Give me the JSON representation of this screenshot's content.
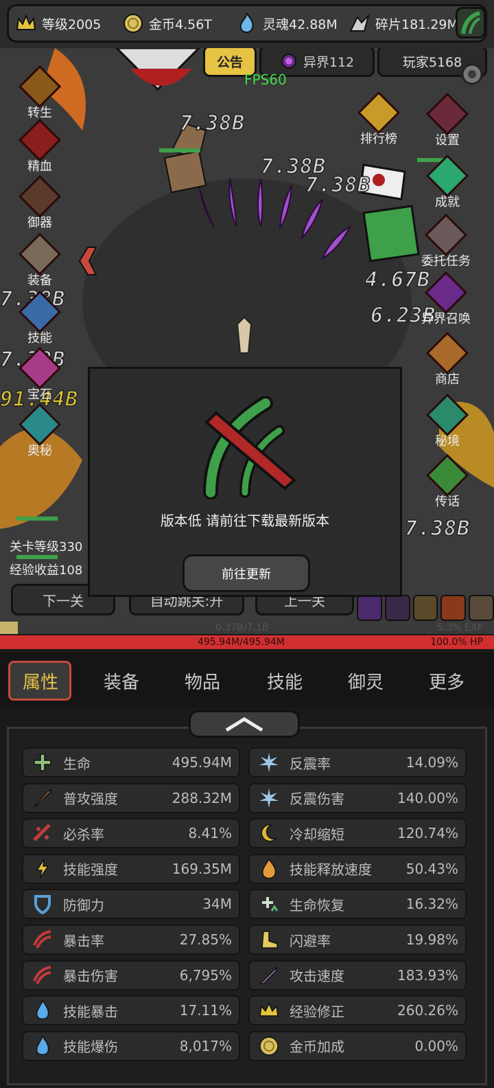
{
  "topbar": {
    "level": "等级2005",
    "gold": "金币4.56T",
    "soul": "灵魂42.88M",
    "shard": "碎片181.29M"
  },
  "header": {
    "notice_tab": "公告",
    "realm_label": "异界112",
    "players": "玩家5168",
    "fps": "FPS60"
  },
  "left_menu": [
    "转生",
    "精血",
    "御器",
    "装备",
    "技能",
    "宝石",
    "奥秘"
  ],
  "right_menu": [
    "设置",
    "排行榜",
    "成就",
    "委托任务",
    "异界召唤",
    "商店",
    "秘境",
    "传话"
  ],
  "damage_numbers": [
    "7.38B",
    "7.38B",
    "7.38B",
    "4.67B",
    "6.23B",
    "7.38B",
    "7.38B",
    "7.38B",
    "91.44B"
  ],
  "stage_info": {
    "stage_level": "关卡等级330",
    "exp_income": "经验收益108"
  },
  "stage_nav": {
    "next": "下一关",
    "auto": "自动跳关:开",
    "prev": "上一关"
  },
  "popup": {
    "message": "版本低 请前往下载最新版本",
    "button": "前往更新"
  },
  "exp": {
    "text": "0.37B/7.1B",
    "percent_text": "5.3% EXP",
    "fraction": 0.053
  },
  "hp": {
    "text": "495.94M/495.94M",
    "percent_text": "100.0%  HP",
    "fraction": 1.0
  },
  "tabs": [
    "属性",
    "装备",
    "物品",
    "技能",
    "御灵",
    "更多"
  ],
  "stats_left": [
    {
      "name": "生命",
      "value": "495.94M",
      "icon": "plus-icon",
      "color": "#8fbf7a"
    },
    {
      "name": "普攻强度",
      "value": "288.32M",
      "icon": "arrow-icon",
      "color": "#d08a2a"
    },
    {
      "name": "必杀率",
      "value": "8.41%",
      "icon": "slash-icon",
      "color": "#c23b3b"
    },
    {
      "name": "技能强度",
      "value": "169.35M",
      "icon": "lightning-icon",
      "color": "#e2c33a"
    },
    {
      "name": "防御力",
      "value": "34M",
      "icon": "shield-icon",
      "color": "#5aa0d8"
    },
    {
      "name": "暴击率",
      "value": "27.85%",
      "icon": "claw-icon",
      "color": "#c23b3b"
    },
    {
      "name": "暴击伤害",
      "value": "6,795%",
      "icon": "claw-icon",
      "color": "#c23b3b"
    },
    {
      "name": "技能暴击",
      "value": "17.11%",
      "icon": "flame-blue-icon",
      "color": "#5aa8e8"
    },
    {
      "name": "技能爆伤",
      "value": "8,017%",
      "icon": "flame-blue-icon",
      "color": "#5aa8e8"
    }
  ],
  "stats_right": [
    {
      "name": "反震率",
      "value": "14.09%",
      "icon": "shatter-icon",
      "color": "#9cc8e8"
    },
    {
      "name": "反震伤害",
      "value": "140.00%",
      "icon": "shatter-icon",
      "color": "#9cc8e8"
    },
    {
      "name": "冷却缩短",
      "value": "120.74%",
      "icon": "moon-icon",
      "color": "#e2b43a"
    },
    {
      "name": "技能释放速度",
      "value": "50.43%",
      "icon": "fire-icon",
      "color": "#e29a3a"
    },
    {
      "name": "生命恢复",
      "value": "16.32%",
      "icon": "regen-icon",
      "color": "#d0e0d0"
    },
    {
      "name": "闪避率",
      "value": "19.98%",
      "icon": "boot-icon",
      "color": "#e2c860"
    },
    {
      "name": "攻击速度",
      "value": "183.93%",
      "icon": "sword-icon",
      "color": "#b88ad8"
    },
    {
      "name": "经验修正",
      "value": "260.26%",
      "icon": "crown-icon",
      "color": "#e2c33a"
    },
    {
      "name": "金币加成",
      "value": "0.00%",
      "icon": "coin-icon",
      "color": "#d8c060"
    }
  ]
}
